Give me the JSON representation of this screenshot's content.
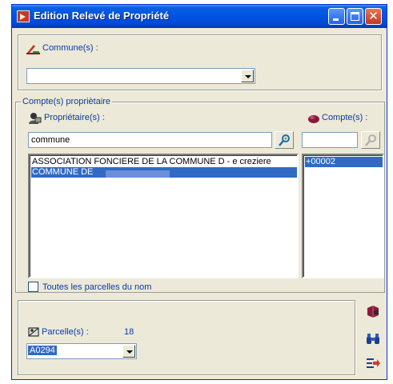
{
  "window": {
    "title": "Edition Relevé de Propriété",
    "buttons": {
      "minimize": "minimize-icon",
      "maximize": "maximize-icon",
      "close": "close-icon"
    }
  },
  "commune": {
    "label": "Commune(s) :",
    "value": ""
  },
  "proprietaire_group": {
    "legend": "Compte(s) propriètaire",
    "proprietaires": {
      "label": "Propriétaire(s) :",
      "search_value": "commune",
      "items": [
        {
          "text": "ASSOCIATION FONCIERE DE LA COMMUNE D - e creziere",
          "selected": false
        },
        {
          "text": "COMMUNE DE",
          "selected": true
        }
      ]
    },
    "comptes": {
      "label": "Compte(s) :",
      "search_value": "",
      "items": [
        {
          "text": "+00002",
          "selected": true
        }
      ]
    },
    "checkbox": {
      "label": "Toutes les parcelles du nom",
      "checked": false
    }
  },
  "parcelle": {
    "label": "Parcelle(s) :",
    "count": "18",
    "value": "A0294"
  },
  "colors": {
    "title_bar": "#0054e3",
    "selection": "#316ac5",
    "label_text": "#0a3aa8",
    "window_bg": "#ece9d8"
  }
}
